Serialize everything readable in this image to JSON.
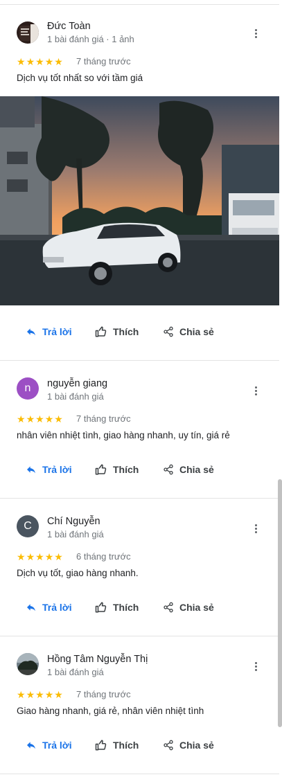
{
  "actions": {
    "reply": "Trả lời",
    "like": "Thích",
    "share": "Chia sẻ"
  },
  "colors": {
    "star": "#fbbc04",
    "reply": "#1a73e8",
    "avatar_n": "#9c4fc4",
    "avatar_c": "#4a5560"
  },
  "reviews": [
    {
      "name": "Đức Toàn",
      "meta": "1 bài đánh giá · 1 ảnh",
      "avatar_kind": "photo",
      "rating": 5,
      "time": "7 tháng trước",
      "text": "Dịch vụ tốt nhất so với tầm giá"
    },
    {
      "name": "nguyễn giang",
      "meta": "1 bài đánh giá",
      "avatar_letter": "n",
      "rating": 5,
      "time": "7 tháng trước",
      "text": "nhân viên nhiệt tình, giao hàng nhanh, uy tín, giá rẻ"
    },
    {
      "name": "Chí Nguyễn",
      "meta": "1 bài đánh giá",
      "avatar_letter": "C",
      "rating": 5,
      "time": "6 tháng trước",
      "text": "Dịch vụ tốt, giao hàng nhanh."
    },
    {
      "name": "Hồng Tâm Nguyễn Thị",
      "meta": "1 bài đánh giá",
      "avatar_kind": "photo",
      "rating": 5,
      "time": "7 tháng trước",
      "text": "Giao hàng nhanh, giá rẻ, nhân viên nhiệt tình"
    }
  ]
}
